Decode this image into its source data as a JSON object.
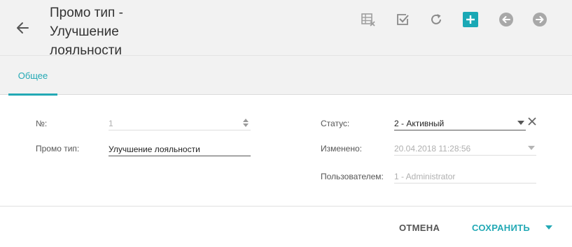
{
  "header": {
    "title": "Промо тип - Улучшение лояльности"
  },
  "toolbar": {
    "icons": [
      "table-delete-icon",
      "checkbox-icon",
      "refresh-icon",
      "add-icon",
      "previous-icon",
      "next-icon"
    ],
    "accent_color": "#1aa8b5",
    "muted_color": "#9e9e9e"
  },
  "tabs": [
    {
      "label": "Общее",
      "active": true
    }
  ],
  "form": {
    "number": {
      "label": "№:",
      "value": "1"
    },
    "promo_type": {
      "label": "Промо тип:",
      "value": "Улучшение лояльности"
    },
    "status": {
      "label": "Статус:",
      "value": "2 - Активный"
    },
    "changed": {
      "label": "Изменено:",
      "value": "20.04.2018 11:28:56"
    },
    "user": {
      "label": "Пользователем:",
      "value": "1 - Administrator"
    }
  },
  "footer": {
    "cancel_label": "ОТМЕНА",
    "save_label": "СОХРАНИТЬ"
  }
}
